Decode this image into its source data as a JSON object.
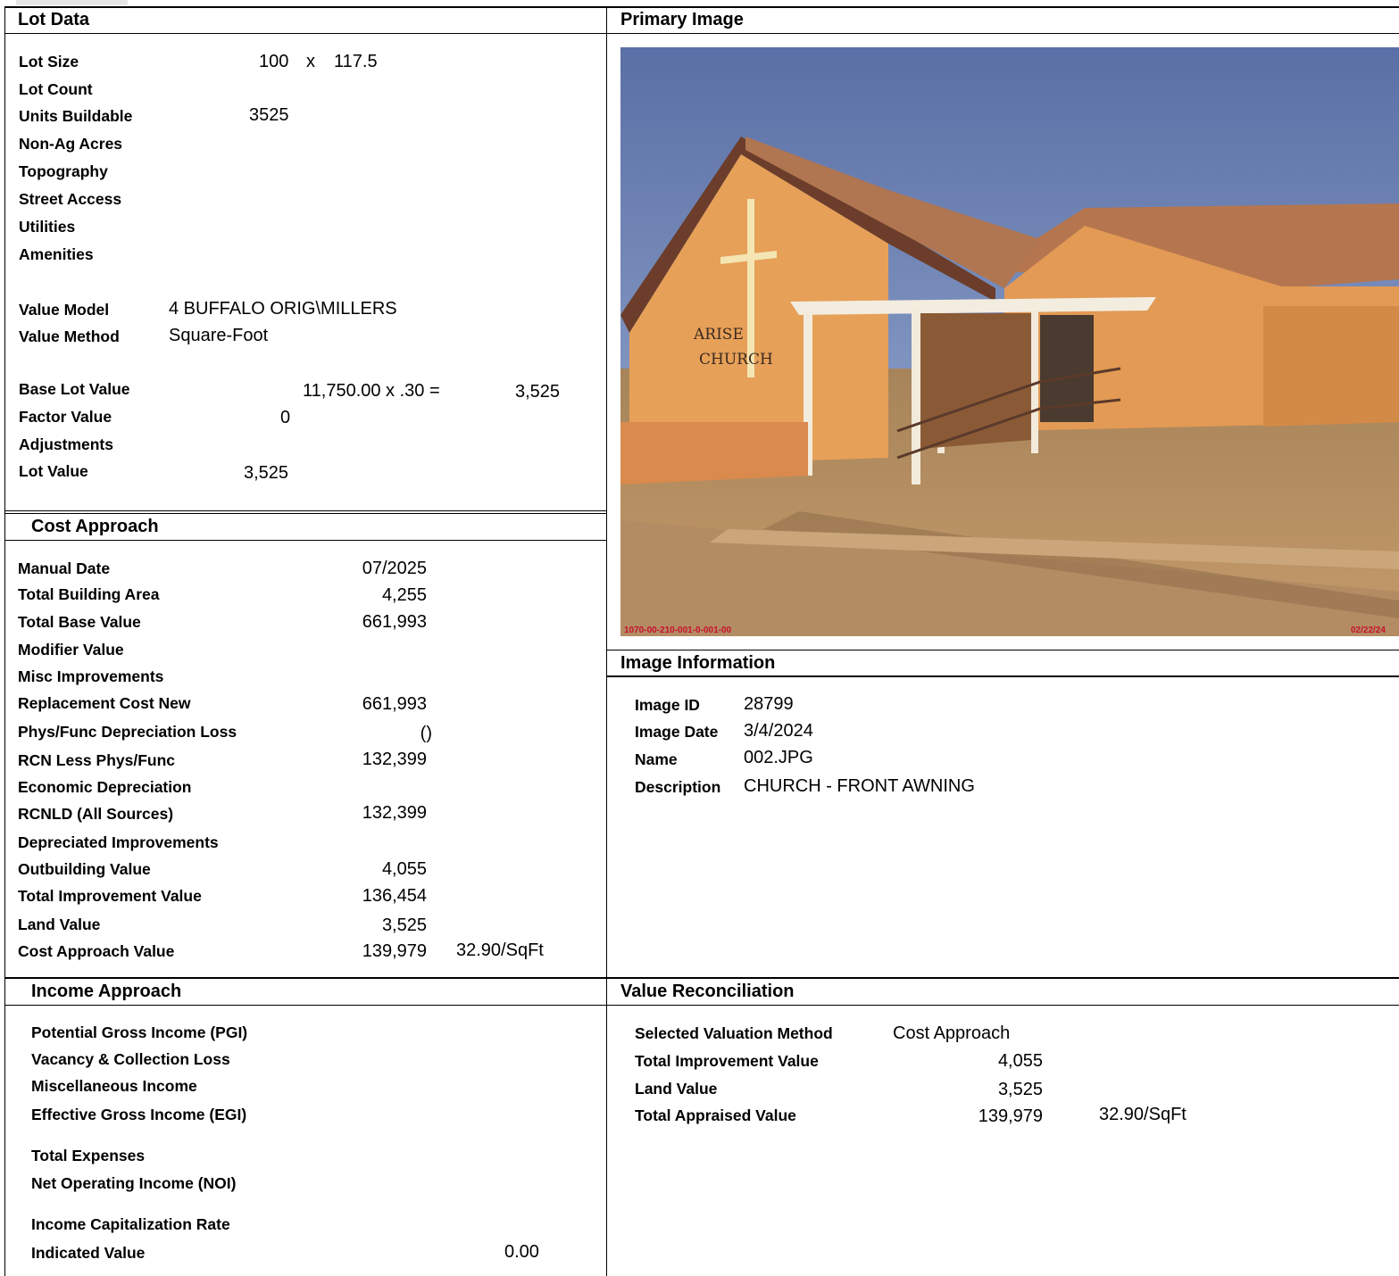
{
  "lot_data": {
    "title": "Lot Data",
    "lot_size_label": "Lot Size",
    "lot_size_w": "100",
    "lot_size_x": "x",
    "lot_size_d": "117.5",
    "lot_count_label": "Lot Count",
    "units_buildable_label": "Units Buildable",
    "units_buildable_value": "3525",
    "non_ag_acres_label": "Non-Ag Acres",
    "topography_label": "Topography",
    "street_access_label": "Street Access",
    "utilities_label": "Utilities",
    "amenities_label": "Amenities",
    "value_model_label": "Value Model",
    "value_model_value": "4 BUFFALO ORIG\\MILLERS",
    "value_method_label": "Value Method",
    "value_method_value": "Square-Foot",
    "base_lot_value_label": "Base Lot Value",
    "base_lot_formula": "11,750.00 x .30 =",
    "base_lot_result": "3,525",
    "factor_value_label": "Factor Value",
    "factor_value_value": "0",
    "adjustments_label": "Adjustments",
    "lot_value_label": "Lot Value",
    "lot_value_value": "3,525"
  },
  "cost_approach": {
    "title": "Cost Approach",
    "rows": [
      {
        "label": "Manual Date",
        "value": "07/2025"
      },
      {
        "label": "Total Building Area",
        "value": "4,255"
      },
      {
        "label": "Total Base Value",
        "value": "661,993"
      },
      {
        "label": "Modifier Value",
        "value": ""
      },
      {
        "label": "Misc Improvements",
        "value": ""
      },
      {
        "label": "Replacement Cost New",
        "value": "661,993"
      },
      {
        "label": "Phys/Func Depreciation Loss",
        "value": "()"
      },
      {
        "label": "RCN Less Phys/Func",
        "value": "132,399"
      },
      {
        "label": "Economic Depreciation",
        "value": ""
      },
      {
        "label": "RCNLD (All Sources)",
        "value": "132,399"
      },
      {
        "label": "Depreciated Improvements",
        "value": ""
      },
      {
        "label": "Outbuilding Value",
        "value": "4,055"
      },
      {
        "label": "Total Improvement Value",
        "value": "136,454"
      },
      {
        "label": "Land Value",
        "value": "3,525"
      },
      {
        "label": "Cost Approach Value",
        "value": "139,979"
      }
    ],
    "per_sqft": "32.90/SqFt"
  },
  "income_approach": {
    "title": "Income Approach",
    "pgi_label": "Potential Gross Income (PGI)",
    "vacancy_label": "Vacancy & Collection Loss",
    "misc_income_label": "Miscellaneous Income",
    "egi_label": "Effective Gross Income (EGI)",
    "total_expenses_label": "Total Expenses",
    "noi_label": "Net Operating Income (NOI)",
    "cap_rate_label": "Income Capitalization Rate",
    "indicated_value_label": "Indicated Value",
    "indicated_value_value": "0.00"
  },
  "primary_image": {
    "title": "Primary Image",
    "caption_left": "1070-00-210-001-0-001-00",
    "caption_right": "02/22/24",
    "sign_line1": "ARISE",
    "sign_line2": "CHURCH"
  },
  "image_information": {
    "title": "Image Information",
    "image_id_label": "Image ID",
    "image_id_value": "28799",
    "image_date_label": "Image Date",
    "image_date_value": "3/4/2024",
    "name_label": "Name",
    "name_value": "002.JPG",
    "description_label": "Description",
    "description_value": "CHURCH - FRONT AWNING"
  },
  "value_reconciliation": {
    "title": "Value Reconciliation",
    "method_label": "Selected Valuation Method",
    "method_value": "Cost Approach",
    "improvement_label": "Total Improvement Value",
    "improvement_value": "4,055",
    "land_label": "Land Value",
    "land_value": "3,525",
    "appraised_label": "Total Appraised Value",
    "appraised_value": "139,979",
    "appraised_per_sqft": "32.90/SqFt"
  }
}
